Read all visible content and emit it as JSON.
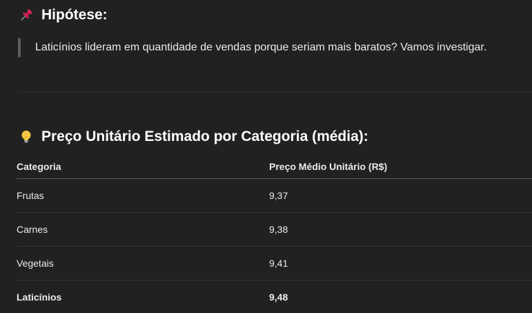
{
  "hypothesis": {
    "icon": "pushpin-icon",
    "title": "Hipótese:",
    "quote": "Laticínios lideram em quantidade de vendas porque seriam mais baratos? Vamos investigar."
  },
  "price_section": {
    "icon": "lightbulb-icon",
    "title": "Preço Unitário Estimado por Categoria (média):",
    "table": {
      "headers": [
        "Categoria",
        "Preço Médio Unitário (R$)"
      ],
      "rows": [
        {
          "category": "Frutas",
          "price": "9,37"
        },
        {
          "category": "Carnes",
          "price": "9,38"
        },
        {
          "category": "Vegetais",
          "price": "9,41"
        },
        {
          "category": "Laticínios",
          "price": "9,48"
        }
      ]
    }
  },
  "colors": {
    "background": "#212121",
    "text": "#ececec",
    "pin": "#e0245e",
    "bulb": "#f4c542"
  }
}
